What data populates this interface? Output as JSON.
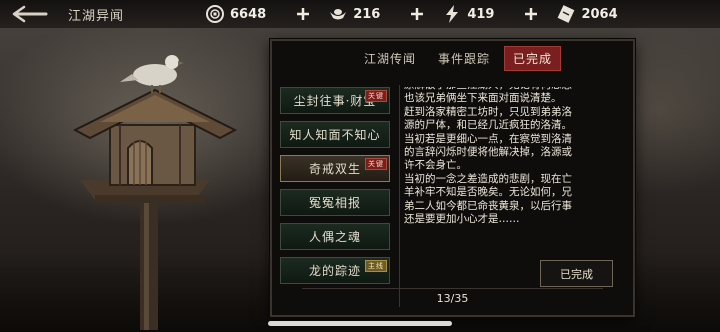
{
  "header": {
    "title": "江湖异闻",
    "resources": [
      {
        "icon": "copper-coin-icon",
        "value": "6648"
      },
      {
        "icon": "silver-ingot-icon",
        "value": "216"
      },
      {
        "icon": "lightning-energy-icon",
        "value": "419"
      },
      {
        "icon": "ticket-icon",
        "value": "2064"
      }
    ]
  },
  "tabs": [
    {
      "label": "江湖传闻",
      "active": false
    },
    {
      "label": "事件跟踪",
      "active": false
    },
    {
      "label": "已完成",
      "active": true
    }
  ],
  "events": [
    {
      "label": "尘封往事·财宝",
      "badge": "关键",
      "selected": false
    },
    {
      "label": "知人知面不知心",
      "badge": "",
      "selected": false
    },
    {
      "label": "奇戒双生",
      "badge": "关键",
      "selected": true
    },
    {
      "label": "冤冤相报",
      "badge": "",
      "selected": false
    },
    {
      "label": "人偶之魂",
      "badge": "",
      "selected": false
    },
    {
      "label": "龙的踪迹",
      "badge": "主线",
      "selected": false
    }
  ],
  "story": {
    "text": "原解散了那些江湖人，无论有何恩怨\n也该兄弟俩坐下来面对面说清楚。\n赶到洛家精密工坊时，只见到弟弟洛\n源的尸体，和已经几近疯狂的洛清。\n当初若是更细心一点，在察觉到洛清\n的言辞闪烁时便将他解决掉，洛源或\n许不会身亡。\n当初的一念之差造成的悲剧，现在亡\n羊补牢不知是否晚矣。无论如何，兄\n弟二人如今都已命丧黄泉，以后行事\n还是要更加小心才是……"
  },
  "done_button": "已完成",
  "pager": "13/35",
  "colors": {
    "active_tab": "#7a1f1f",
    "badge_key": "#7c1e1a",
    "badge_main": "#6d5a24"
  }
}
